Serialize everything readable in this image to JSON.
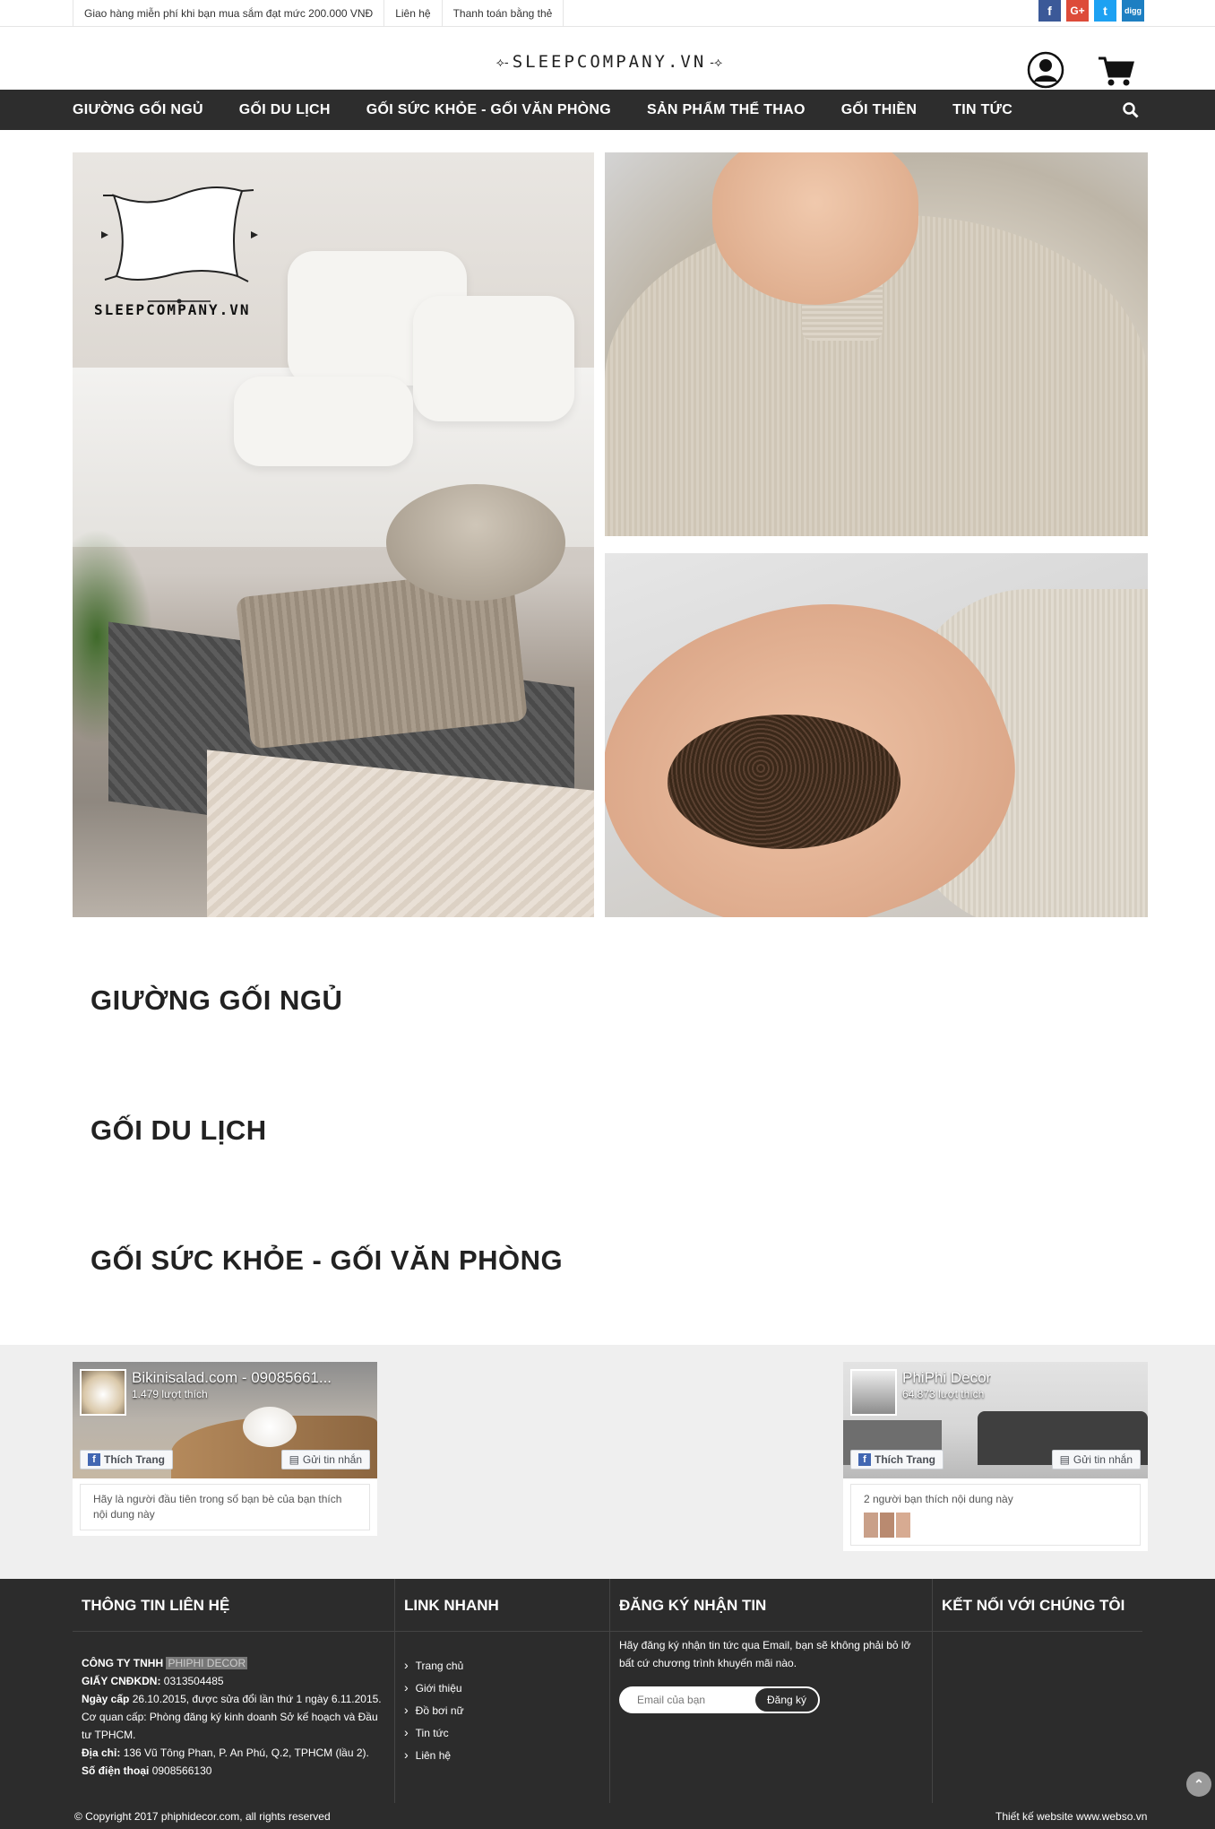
{
  "topbar": {
    "links": [
      "Giao hàng miễn phí khi bạn mua sắm đạt mức 200.000 VNĐ",
      "Liên hệ",
      "Thanh toán bằng thẻ"
    ],
    "social": [
      {
        "icon": "facebook-icon",
        "glyph": "f",
        "color": "#3b5998"
      },
      {
        "icon": "google-plus-icon",
        "glyph": "G+",
        "color": "#dd4b39"
      },
      {
        "icon": "twitter-icon",
        "glyph": "t",
        "color": "#1da1f2"
      },
      {
        "icon": "digg-icon",
        "glyph": "digg",
        "color": "#1d7fc2"
      }
    ]
  },
  "header": {
    "logo_text": "SLEEPCOMPANY.VN",
    "user_icon": "user-icon",
    "cart_icon": "cart-icon"
  },
  "nav": {
    "items": [
      "GIƯỜNG GỐI NGỦ",
      "GỐI DU LỊCH",
      "GỐI SỨC KHỎE - GỐI VĂN PHÒNG",
      "SẢN PHẨM THỂ THAO",
      "GỐI THIỀN",
      "TIN TỨC"
    ],
    "search_icon": "search-icon"
  },
  "banner": {
    "watermark_text": "SLEEPCOMPANY.VN"
  },
  "categories": [
    "GIƯỜNG GỐI NGỦ",
    "GỐI DU LỊCH",
    "GỐI SỨC KHỎE - GỐI VĂN PHÒNG"
  ],
  "fb_widgets": [
    {
      "title": "Bikinisalad.com - 09085661...",
      "likes": "1.479 lượt thích",
      "like_label": "Thích Trang",
      "message_label": "Gửi tin nhắn",
      "footer": "Hãy là người đầu tiên trong số bạn bè của bạn thích nội dung này"
    },
    {
      "title": "PhiPhi Decor",
      "likes": "64.873 lượt thích",
      "like_label": "Thích Trang",
      "message_label": "Gửi tin nhắn",
      "footer": "2 người bạn thích nội dung này"
    }
  ],
  "footer": {
    "contact_title": "THÔNG TIN LIÊN HỆ",
    "company_label": "CÔNG TY TNHH",
    "company_name": "PHIPHI DECOR",
    "license_label": "GIẤY CNĐKDN:",
    "license_value": "0313504485",
    "issue_label": "Ngày cấp",
    "issue_value": "26.10.2015, được sửa đổi lần thứ 1 ngày 6.11.2015.",
    "agency": "Cơ quan cấp: Phòng đăng ký kinh doanh Sở kế hoạch và Đầu tư TPHCM.",
    "address_label": "Địa chỉ:",
    "address_value": "136 Vũ Tông Phan, P. An Phú, Q.2, TPHCM (lầu 2).",
    "phone_label": "Số điện thoại",
    "phone_value": "0908566130",
    "quick_title": "LINK NHANH",
    "quick_links": [
      "Trang chủ",
      "Giới thiệu",
      "Đồ bơi nữ",
      "Tin tức",
      "Liên hệ"
    ],
    "subscribe_title": "ĐĂNG KÝ NHẬN TIN",
    "subscribe_text": "Hãy đăng ký nhận tin tức qua Email, bạn sẽ không phải bỏ lỡ bất cứ chương trình khuyến mãi nào.",
    "email_placeholder": "Email của bạn",
    "subscribe_button": "Đăng ký",
    "connect_title": "KẾT NỐI VỚI CHÚNG TÔI",
    "copyright": "© Copyright 2017 phiphidecor.com, all rights reserved",
    "credit": "Thiết kế website www.webso.vn"
  }
}
